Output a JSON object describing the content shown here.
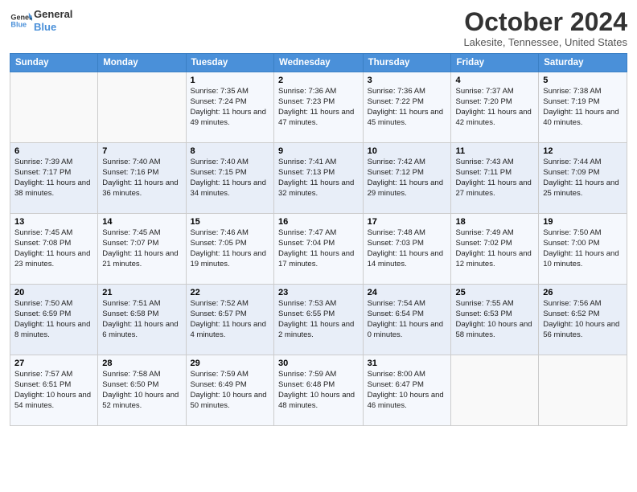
{
  "header": {
    "logo_line1": "General",
    "logo_line2": "Blue",
    "month": "October 2024",
    "location": "Lakesite, Tennessee, United States"
  },
  "weekdays": [
    "Sunday",
    "Monday",
    "Tuesday",
    "Wednesday",
    "Thursday",
    "Friday",
    "Saturday"
  ],
  "weeks": [
    [
      {
        "num": "",
        "sunrise": "",
        "sunset": "",
        "daylight": "",
        "empty": true
      },
      {
        "num": "",
        "sunrise": "",
        "sunset": "",
        "daylight": "",
        "empty": true
      },
      {
        "num": "1",
        "sunrise": "Sunrise: 7:35 AM",
        "sunset": "Sunset: 7:24 PM",
        "daylight": "Daylight: 11 hours and 49 minutes."
      },
      {
        "num": "2",
        "sunrise": "Sunrise: 7:36 AM",
        "sunset": "Sunset: 7:23 PM",
        "daylight": "Daylight: 11 hours and 47 minutes."
      },
      {
        "num": "3",
        "sunrise": "Sunrise: 7:36 AM",
        "sunset": "Sunset: 7:22 PM",
        "daylight": "Daylight: 11 hours and 45 minutes."
      },
      {
        "num": "4",
        "sunrise": "Sunrise: 7:37 AM",
        "sunset": "Sunset: 7:20 PM",
        "daylight": "Daylight: 11 hours and 42 minutes."
      },
      {
        "num": "5",
        "sunrise": "Sunrise: 7:38 AM",
        "sunset": "Sunset: 7:19 PM",
        "daylight": "Daylight: 11 hours and 40 minutes."
      }
    ],
    [
      {
        "num": "6",
        "sunrise": "Sunrise: 7:39 AM",
        "sunset": "Sunset: 7:17 PM",
        "daylight": "Daylight: 11 hours and 38 minutes."
      },
      {
        "num": "7",
        "sunrise": "Sunrise: 7:40 AM",
        "sunset": "Sunset: 7:16 PM",
        "daylight": "Daylight: 11 hours and 36 minutes."
      },
      {
        "num": "8",
        "sunrise": "Sunrise: 7:40 AM",
        "sunset": "Sunset: 7:15 PM",
        "daylight": "Daylight: 11 hours and 34 minutes."
      },
      {
        "num": "9",
        "sunrise": "Sunrise: 7:41 AM",
        "sunset": "Sunset: 7:13 PM",
        "daylight": "Daylight: 11 hours and 32 minutes."
      },
      {
        "num": "10",
        "sunrise": "Sunrise: 7:42 AM",
        "sunset": "Sunset: 7:12 PM",
        "daylight": "Daylight: 11 hours and 29 minutes."
      },
      {
        "num": "11",
        "sunrise": "Sunrise: 7:43 AM",
        "sunset": "Sunset: 7:11 PM",
        "daylight": "Daylight: 11 hours and 27 minutes."
      },
      {
        "num": "12",
        "sunrise": "Sunrise: 7:44 AM",
        "sunset": "Sunset: 7:09 PM",
        "daylight": "Daylight: 11 hours and 25 minutes."
      }
    ],
    [
      {
        "num": "13",
        "sunrise": "Sunrise: 7:45 AM",
        "sunset": "Sunset: 7:08 PM",
        "daylight": "Daylight: 11 hours and 23 minutes."
      },
      {
        "num": "14",
        "sunrise": "Sunrise: 7:45 AM",
        "sunset": "Sunset: 7:07 PM",
        "daylight": "Daylight: 11 hours and 21 minutes."
      },
      {
        "num": "15",
        "sunrise": "Sunrise: 7:46 AM",
        "sunset": "Sunset: 7:05 PM",
        "daylight": "Daylight: 11 hours and 19 minutes."
      },
      {
        "num": "16",
        "sunrise": "Sunrise: 7:47 AM",
        "sunset": "Sunset: 7:04 PM",
        "daylight": "Daylight: 11 hours and 17 minutes."
      },
      {
        "num": "17",
        "sunrise": "Sunrise: 7:48 AM",
        "sunset": "Sunset: 7:03 PM",
        "daylight": "Daylight: 11 hours and 14 minutes."
      },
      {
        "num": "18",
        "sunrise": "Sunrise: 7:49 AM",
        "sunset": "Sunset: 7:02 PM",
        "daylight": "Daylight: 11 hours and 12 minutes."
      },
      {
        "num": "19",
        "sunrise": "Sunrise: 7:50 AM",
        "sunset": "Sunset: 7:00 PM",
        "daylight": "Daylight: 11 hours and 10 minutes."
      }
    ],
    [
      {
        "num": "20",
        "sunrise": "Sunrise: 7:50 AM",
        "sunset": "Sunset: 6:59 PM",
        "daylight": "Daylight: 11 hours and 8 minutes."
      },
      {
        "num": "21",
        "sunrise": "Sunrise: 7:51 AM",
        "sunset": "Sunset: 6:58 PM",
        "daylight": "Daylight: 11 hours and 6 minutes."
      },
      {
        "num": "22",
        "sunrise": "Sunrise: 7:52 AM",
        "sunset": "Sunset: 6:57 PM",
        "daylight": "Daylight: 11 hours and 4 minutes."
      },
      {
        "num": "23",
        "sunrise": "Sunrise: 7:53 AM",
        "sunset": "Sunset: 6:55 PM",
        "daylight": "Daylight: 11 hours and 2 minutes."
      },
      {
        "num": "24",
        "sunrise": "Sunrise: 7:54 AM",
        "sunset": "Sunset: 6:54 PM",
        "daylight": "Daylight: 11 hours and 0 minutes."
      },
      {
        "num": "25",
        "sunrise": "Sunrise: 7:55 AM",
        "sunset": "Sunset: 6:53 PM",
        "daylight": "Daylight: 10 hours and 58 minutes."
      },
      {
        "num": "26",
        "sunrise": "Sunrise: 7:56 AM",
        "sunset": "Sunset: 6:52 PM",
        "daylight": "Daylight: 10 hours and 56 minutes."
      }
    ],
    [
      {
        "num": "27",
        "sunrise": "Sunrise: 7:57 AM",
        "sunset": "Sunset: 6:51 PM",
        "daylight": "Daylight: 10 hours and 54 minutes."
      },
      {
        "num": "28",
        "sunrise": "Sunrise: 7:58 AM",
        "sunset": "Sunset: 6:50 PM",
        "daylight": "Daylight: 10 hours and 52 minutes."
      },
      {
        "num": "29",
        "sunrise": "Sunrise: 7:59 AM",
        "sunset": "Sunset: 6:49 PM",
        "daylight": "Daylight: 10 hours and 50 minutes."
      },
      {
        "num": "30",
        "sunrise": "Sunrise: 7:59 AM",
        "sunset": "Sunset: 6:48 PM",
        "daylight": "Daylight: 10 hours and 48 minutes."
      },
      {
        "num": "31",
        "sunrise": "Sunrise: 8:00 AM",
        "sunset": "Sunset: 6:47 PM",
        "daylight": "Daylight: 10 hours and 46 minutes."
      },
      {
        "num": "",
        "sunrise": "",
        "sunset": "",
        "daylight": "",
        "empty": true
      },
      {
        "num": "",
        "sunrise": "",
        "sunset": "",
        "daylight": "",
        "empty": true
      }
    ]
  ]
}
